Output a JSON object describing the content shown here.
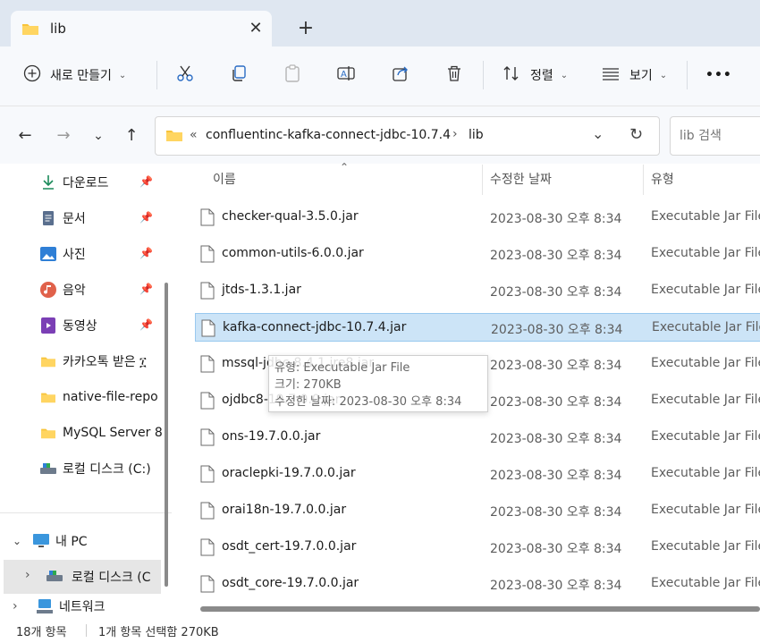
{
  "window": {
    "tab_title": "lib"
  },
  "toolbar": {
    "new_label": "새로 만들기",
    "sort_label": "정렬",
    "view_label": "보기",
    "more_label": "•••"
  },
  "address": {
    "overflow": "«",
    "crumb_parent": "confluentinc-kafka-connect-jdbc-10.7.4",
    "sep": "›",
    "crumb_current": "lib"
  },
  "search": {
    "placeholder": "lib 검색"
  },
  "sidebar": {
    "items": [
      {
        "label": "다운로드",
        "icon": "download-icon",
        "pinned": true
      },
      {
        "label": "문서",
        "icon": "document-icon",
        "pinned": true
      },
      {
        "label": "사진",
        "icon": "picture-icon",
        "pinned": true
      },
      {
        "label": "음악",
        "icon": "music-icon",
        "pinned": true
      },
      {
        "label": "동영상",
        "icon": "video-icon",
        "pinned": true
      },
      {
        "label": "카카오톡 받은 ፲",
        "icon": "folder-icon",
        "pinned": false
      },
      {
        "label": "native-file-repo",
        "icon": "folder-icon",
        "pinned": false
      },
      {
        "label": "MySQL Server 8",
        "icon": "folder-icon",
        "pinned": false
      },
      {
        "label": "로컬 디스크 (C:)",
        "icon": "drive-icon",
        "pinned": false
      }
    ],
    "this_pc": "내 PC",
    "this_pc_child": "로컬 디스크 (C",
    "network": "네트워크"
  },
  "columns": {
    "name": "이름",
    "date": "수정한 날짜",
    "type": "유형"
  },
  "files": [
    {
      "name": "checker-qual-3.5.0.jar",
      "date": "2023-08-30 오후 8:34",
      "type": "Executable Jar File"
    },
    {
      "name": "common-utils-6.0.0.jar",
      "date": "2023-08-30 오후 8:34",
      "type": "Executable Jar File"
    },
    {
      "name": "jtds-1.3.1.jar",
      "date": "2023-08-30 오후 8:34",
      "type": "Executable Jar File"
    },
    {
      "name": "kafka-connect-jdbc-10.7.4.jar",
      "date": "2023-08-30 오후 8:34",
      "type": "Executable Jar File",
      "selected": true
    },
    {
      "name": "mssql-jdbc-8.4.1.jre8.jar",
      "date": "2023-08-30 오후 8:34",
      "type": "Executable Jar File"
    },
    {
      "name": "ojdbc8-19.7.0.0.jar",
      "date": "2023-08-30 오후 8:34",
      "type": "Executable Jar File"
    },
    {
      "name": "ons-19.7.0.0.jar",
      "date": "2023-08-30 오후 8:34",
      "type": "Executable Jar File"
    },
    {
      "name": "oraclepki-19.7.0.0.jar",
      "date": "2023-08-30 오후 8:34",
      "type": "Executable Jar File"
    },
    {
      "name": "orai18n-19.7.0.0.jar",
      "date": "2023-08-30 오후 8:34",
      "type": "Executable Jar File"
    },
    {
      "name": "osdt_cert-19.7.0.0.jar",
      "date": "2023-08-30 오후 8:34",
      "type": "Executable Jar File"
    },
    {
      "name": "osdt_core-19.7.0.0.jar",
      "date": "2023-08-30 오후 8:34",
      "type": "Executable Jar File"
    }
  ],
  "tooltip": {
    "line1": "유형: Executable Jar File",
    "line2": "크기: 270KB",
    "line3": "수정한 날짜: 2023-08-30 오후 8:34"
  },
  "status": {
    "count": "18개 항목",
    "selection": "1개 항목 선택함 270KB"
  },
  "colors": {
    "selected_bg": "#cce4f7",
    "accent": "#0067c0",
    "folder": "#f8c43a"
  }
}
